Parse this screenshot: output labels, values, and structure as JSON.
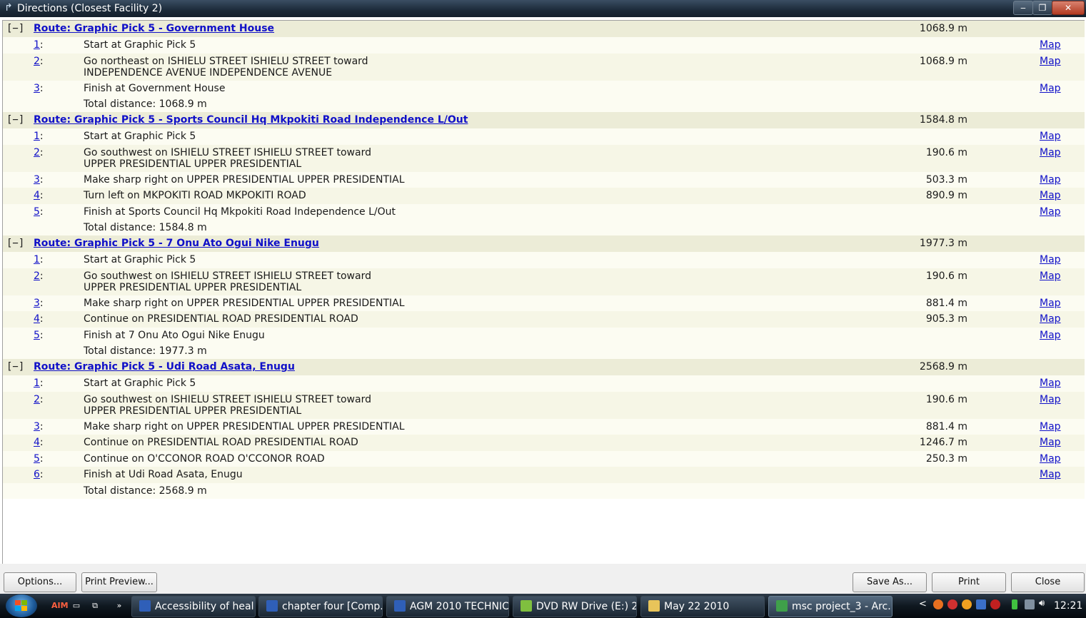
{
  "window": {
    "title": "Directions (Closest Facility 2)"
  },
  "routes": [
    {
      "toggle": "[−]",
      "title": "Route: Graphic Pick 5 - Government House",
      "distance": "1068.9 m",
      "total": "Total distance: 1068.9 m",
      "steps": [
        {
          "num": "1",
          "lines": [
            "Start at Graphic Pick 5"
          ],
          "dist": "",
          "map": "Map"
        },
        {
          "num": "2",
          "lines": [
            "Go northeast on ISHIELU STREET ISHIELU STREET toward",
            "INDEPENDENCE AVENUE INDEPENDENCE AVENUE"
          ],
          "dist": "1068.9 m",
          "map": "Map"
        },
        {
          "num": "3",
          "lines": [
            "Finish at Government House"
          ],
          "dist": "",
          "map": "Map"
        }
      ]
    },
    {
      "toggle": "[−]",
      "title": "Route: Graphic Pick 5 - Sports Council Hq Mkpokiti Road Independence L/Out",
      "distance": "1584.8 m",
      "total": "Total distance: 1584.8 m",
      "steps": [
        {
          "num": "1",
          "lines": [
            "Start at Graphic Pick 5"
          ],
          "dist": "",
          "map": "Map"
        },
        {
          "num": "2",
          "lines": [
            "Go southwest on ISHIELU STREET ISHIELU STREET toward",
            "UPPER PRESIDENTIAL UPPER PRESIDENTIAL"
          ],
          "dist": "190.6 m",
          "map": "Map"
        },
        {
          "num": "3",
          "lines": [
            "Make sharp right on UPPER PRESIDENTIAL UPPER PRESIDENTIAL"
          ],
          "dist": "503.3 m",
          "map": "Map"
        },
        {
          "num": "4",
          "lines": [
            "Turn left on MKPOKITI ROAD MKPOKITI ROAD"
          ],
          "dist": "890.9 m",
          "map": "Map"
        },
        {
          "num": "5",
          "lines": [
            "Finish at Sports Council Hq Mkpokiti Road Independence L/Out"
          ],
          "dist": "",
          "map": "Map"
        }
      ]
    },
    {
      "toggle": "[−]",
      "title": "Route: Graphic Pick 5 - 7 Onu Ato Ogui Nike Enugu",
      "distance": "1977.3 m",
      "total": "Total distance: 1977.3 m",
      "steps": [
        {
          "num": "1",
          "lines": [
            "Start at Graphic Pick 5"
          ],
          "dist": "",
          "map": "Map"
        },
        {
          "num": "2",
          "lines": [
            "Go southwest on ISHIELU STREET ISHIELU STREET toward",
            "UPPER PRESIDENTIAL UPPER PRESIDENTIAL"
          ],
          "dist": "190.6 m",
          "map": "Map"
        },
        {
          "num": "3",
          "lines": [
            "Make sharp right on UPPER PRESIDENTIAL UPPER PRESIDENTIAL"
          ],
          "dist": "881.4 m",
          "map": "Map"
        },
        {
          "num": "4",
          "lines": [
            "Continue on PRESIDENTIAL ROAD PRESIDENTIAL ROAD"
          ],
          "dist": "905.3 m",
          "map": "Map"
        },
        {
          "num": "5",
          "lines": [
            "Finish at 7 Onu Ato Ogui Nike Enugu"
          ],
          "dist": "",
          "map": "Map"
        }
      ]
    },
    {
      "toggle": "[−]",
      "title": "Route: Graphic Pick 5 - Udi Road Asata, Enugu",
      "distance": "2568.9 m",
      "total": "Total distance: 2568.9 m",
      "steps": [
        {
          "num": "1",
          "lines": [
            "Start at Graphic Pick 5"
          ],
          "dist": "",
          "map": "Map"
        },
        {
          "num": "2",
          "lines": [
            "Go southwest on ISHIELU STREET ISHIELU STREET toward",
            "UPPER PRESIDENTIAL UPPER PRESIDENTIAL"
          ],
          "dist": "190.6 m",
          "map": "Map"
        },
        {
          "num": "3",
          "lines": [
            "Make sharp right on UPPER PRESIDENTIAL UPPER PRESIDENTIAL"
          ],
          "dist": "881.4 m",
          "map": "Map"
        },
        {
          "num": "4",
          "lines": [
            "Continue on PRESIDENTIAL ROAD PRESIDENTIAL ROAD"
          ],
          "dist": "1246.7 m",
          "map": "Map"
        },
        {
          "num": "5",
          "lines": [
            "Continue on O'CCONOR ROAD O'CCONOR ROAD"
          ],
          "dist": "250.3 m",
          "map": "Map"
        },
        {
          "num": "6",
          "lines": [
            "Finish at Udi Road Asata, Enugu"
          ],
          "dist": "",
          "map": "Map"
        }
      ]
    }
  ],
  "buttons": {
    "options": "Options...",
    "print_preview": "Print Preview...",
    "save_as": "Save As...",
    "print": "Print",
    "close": "Close"
  },
  "taskbar": {
    "quick_launch": [
      "AIM",
      "»"
    ],
    "items": [
      {
        "label": "Accessibility of heal...",
        "icon": "word-document-icon",
        "color": "#2f5fb8"
      },
      {
        "label": "chapter four [Comp...",
        "icon": "word-document-icon",
        "color": "#2f5fb8"
      },
      {
        "label": "AGM 2010 TECHNIC...",
        "icon": "word-document-icon",
        "color": "#2f5fb8"
      },
      {
        "label": "DVD RW Drive (E:) 2...",
        "icon": "folder-icon",
        "color": "#7fbf3f"
      },
      {
        "label": "May 22 2010",
        "icon": "folder-icon",
        "color": "#e8c45a"
      },
      {
        "label": "msc project_3 - Arc...",
        "icon": "arcmap-icon",
        "color": "#3fa04a"
      }
    ],
    "tray_chevron": "<",
    "clock": "12:21"
  }
}
